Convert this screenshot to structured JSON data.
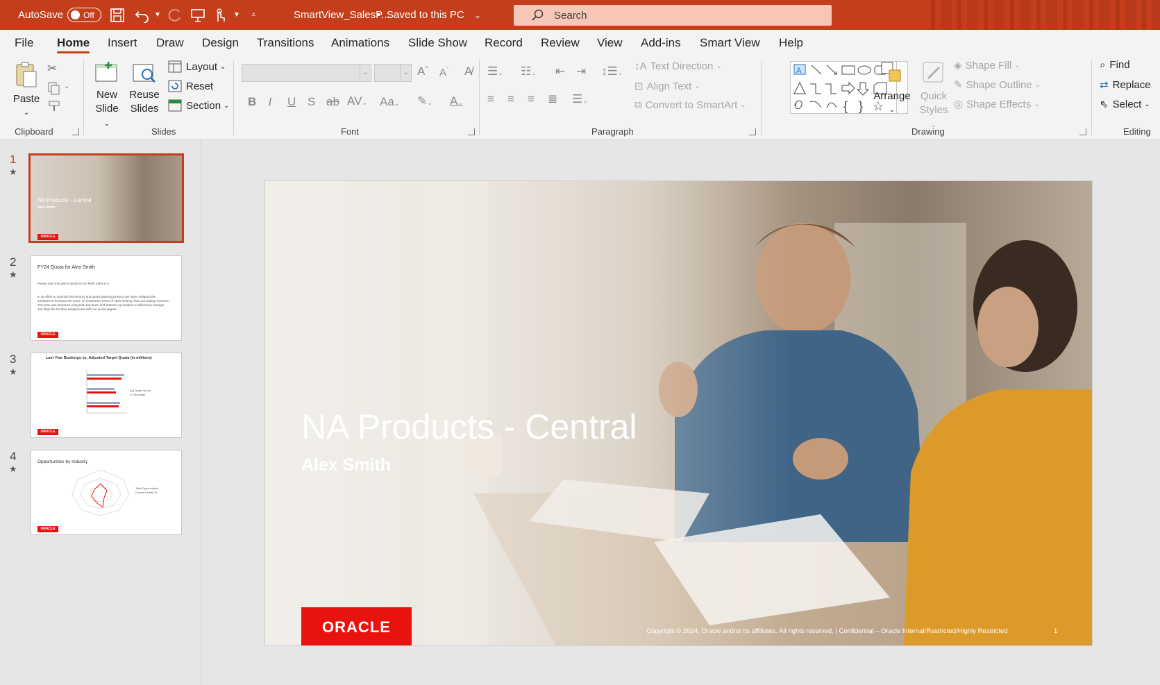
{
  "titlebar": {
    "autosave_label": "AutoSave",
    "autosave_state": "Off",
    "filename": "SmartView_SalesP...",
    "save_status": "Saved to this PC",
    "search_placeholder": "Search"
  },
  "tabs": [
    "File",
    "Home",
    "Insert",
    "Draw",
    "Design",
    "Transitions",
    "Animations",
    "Slide Show",
    "Record",
    "Review",
    "View",
    "Add-ins",
    "Smart View",
    "Help"
  ],
  "active_tab": "Home",
  "ribbon": {
    "clipboard": {
      "label": "Clipboard",
      "paste": "Paste"
    },
    "slides": {
      "label": "Slides",
      "new_slide_1": "New",
      "new_slide_2": "Slide",
      "reuse_1": "Reuse",
      "reuse_2": "Slides",
      "layout": "Layout",
      "reset": "Reset",
      "section": "Section"
    },
    "font": {
      "label": "Font"
    },
    "paragraph": {
      "label": "Paragraph",
      "text_direction": "Text Direction",
      "align_text": "Align Text",
      "convert_smartart": "Convert to SmartArt"
    },
    "drawing": {
      "label": "Drawing",
      "arrange": "Arrange",
      "quick_1": "Quick",
      "quick_2": "Styles",
      "shape_fill": "Shape Fill",
      "shape_outline": "Shape Outline",
      "shape_effects": "Shape Effects"
    },
    "editing": {
      "label": "Editing",
      "find": "Find",
      "replace": "Replace",
      "select": "Select"
    }
  },
  "thumbnails": [
    {
      "num": "1",
      "title": "NA Products - Central",
      "sub": "Alex Smith"
    },
    {
      "num": "2",
      "title": "FY24 Quota for Alex Smith",
      "line1": "Please note this year's quota for NA Field Sales is  0",
      "para": "In an effort to optimize the territory and quota planning process we have realigned the territories to increase the return on investment (ROI) of each territory, thus increasing revenues. This plan was prepared using both top-down and bottoms-up analysis to effectively manage and align the territory assignments with our quota targets."
    },
    {
      "num": "3",
      "title": "Last Year Bookings vs. Adjusted Target Quota (in millions)",
      "legend_1": "Adj Target Quota",
      "legend_2": "LY Bookings"
    },
    {
      "num": "4",
      "title": "Opportunities by Industry",
      "legend_1": "Total Opportunities",
      "legend_2": "Overall Growth %"
    }
  ],
  "slide": {
    "title": "NA Products - Central",
    "subtitle": "Alex Smith",
    "logo": "ORACLE",
    "footer": "Copyright © 2024, Oracle and/or its affiliates. All rights reserved.  |  Confidential – Oracle Internal/Restricted/Highly Restricted",
    "number": "1"
  },
  "colors": {
    "accent": "#c43e1c",
    "oracle_red": "#e8130f",
    "search_bg": "#f6c7b6"
  }
}
